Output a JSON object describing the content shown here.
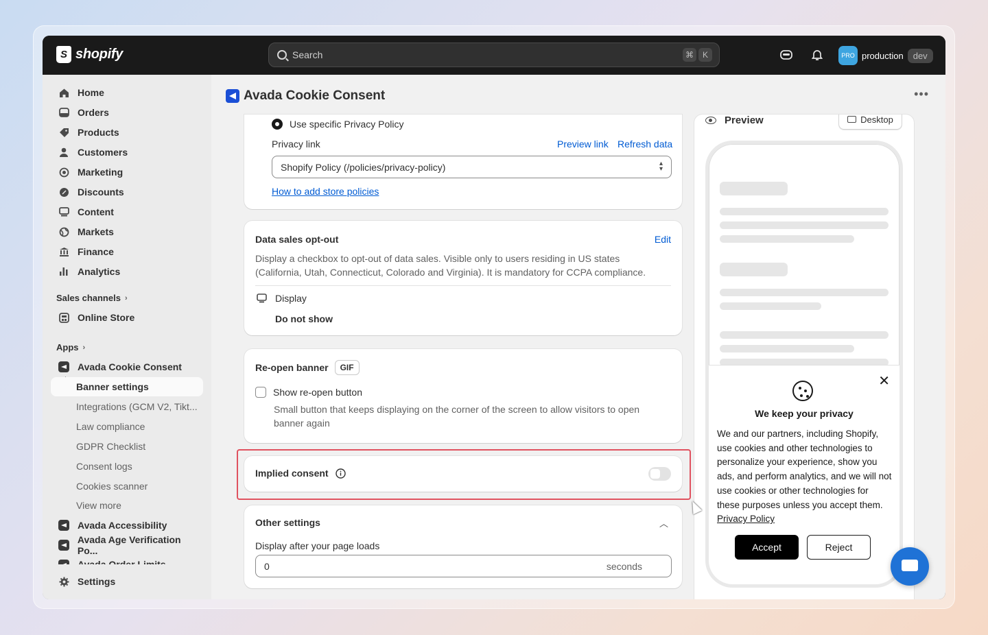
{
  "topbar": {
    "logo_text": "shopify",
    "search_placeholder": "Search",
    "kbd_cmd": "⌘",
    "kbd_k": "K",
    "store_badge": "PRO",
    "store_name": "production",
    "store_tag": "dev"
  },
  "sidebar": {
    "items": [
      {
        "label": "Home",
        "icon": "home-icon"
      },
      {
        "label": "Orders",
        "icon": "orders-icon"
      },
      {
        "label": "Products",
        "icon": "tag-icon"
      },
      {
        "label": "Customers",
        "icon": "person-icon"
      },
      {
        "label": "Marketing",
        "icon": "target-icon"
      },
      {
        "label": "Discounts",
        "icon": "discount-icon"
      },
      {
        "label": "Content",
        "icon": "content-icon"
      },
      {
        "label": "Markets",
        "icon": "globe-icon"
      },
      {
        "label": "Finance",
        "icon": "bank-icon"
      },
      {
        "label": "Analytics",
        "icon": "bar-chart-icon"
      }
    ],
    "sales_channels_label": "Sales channels",
    "online_store_label": "Online Store",
    "apps_label": "Apps",
    "apps": [
      {
        "label": "Avada Cookie Consent"
      },
      {
        "label": "Banner settings"
      },
      {
        "label": "Integrations (GCM V2, Tikt..."
      },
      {
        "label": "Law compliance"
      },
      {
        "label": "GDPR Checklist"
      },
      {
        "label": "Consent logs"
      },
      {
        "label": "Cookies scanner"
      },
      {
        "label": "View more"
      },
      {
        "label": "Avada Accessibility"
      },
      {
        "label": "Avada Age Verification Po..."
      },
      {
        "label": "Avada Order Limits"
      }
    ],
    "settings_label": "Settings"
  },
  "main": {
    "page_title": "Avada Cookie Consent",
    "privacy_card": {
      "radio_label": "Use specific Privacy Policy",
      "privacy_link_label": "Privacy link",
      "preview_link": "Preview link",
      "refresh_data": "Refresh data",
      "select_value": "Shopify Policy (/policies/privacy-policy)",
      "help_link": "How to add store policies"
    },
    "data_sales_card": {
      "title": "Data sales opt-out",
      "edit": "Edit",
      "description": "Display a checkbox to opt-out of data sales. Visible only to users residing in US states (California, Utah, Connecticut, Colorado and Virginia). It is mandatory for CCPA compliance.",
      "display_label": "Display",
      "display_value": "Do not show"
    },
    "reopen_card": {
      "title": "Re-open banner",
      "tag": "GIF",
      "checkbox_label": "Show re-open button",
      "help": "Small button that keeps displaying on the corner of the screen to allow visitors to open banner again"
    },
    "implied_card": {
      "title": "Implied consent",
      "toggle_on": false
    },
    "other_card": {
      "title": "Other settings",
      "field_label": "Display after your page loads",
      "field_value": "0",
      "field_suffix": "seconds"
    }
  },
  "preview": {
    "title": "Preview",
    "device_button": "Desktop",
    "banner": {
      "title": "We keep your privacy",
      "text": "We and our partners, including Shopify, use cookies and other technologies to personalize your experience, show you ads, and perform analytics, and we will not use cookies or other technologies for these purposes unless you accept them.",
      "policy_link": "Privacy Policy",
      "accept": "Accept",
      "reject": "Reject",
      "close": "✕"
    }
  },
  "colors": {
    "accent_link": "#005bd3",
    "topbar": "#1a1a1a",
    "highlight_border": "#e0525f",
    "chat_button": "#1f72d6"
  }
}
